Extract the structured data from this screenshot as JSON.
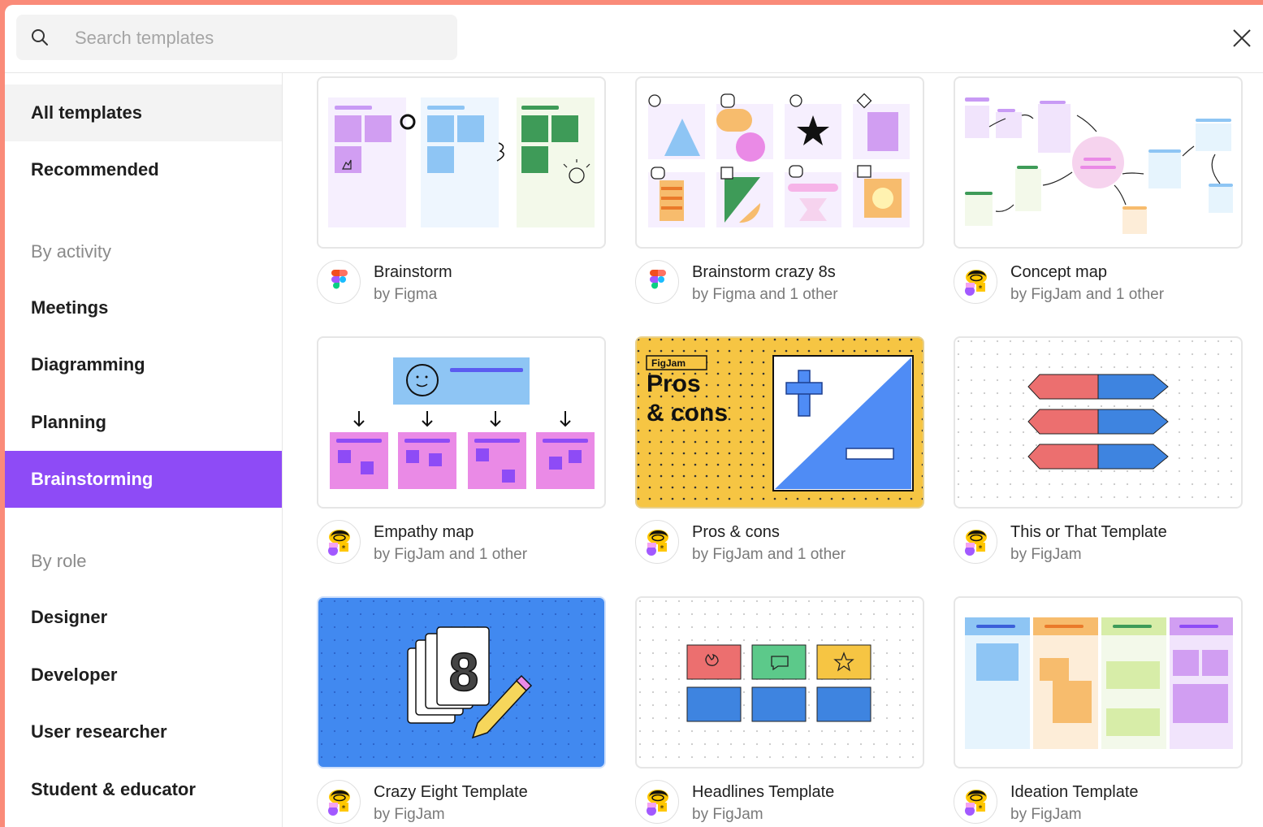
{
  "search": {
    "placeholder": "Search templates"
  },
  "sidebar": {
    "items": [
      {
        "label": "All templates"
      },
      {
        "label": "Recommended"
      },
      {
        "label": "Meetings"
      },
      {
        "label": "Diagramming"
      },
      {
        "label": "Planning"
      },
      {
        "label": "Brainstorming"
      },
      {
        "label": "Designer"
      },
      {
        "label": "Developer"
      },
      {
        "label": "User researcher"
      },
      {
        "label": "Student & educator"
      }
    ],
    "headings": {
      "activity": "By activity",
      "role": "By role"
    }
  },
  "templates": [
    {
      "title": "Brainstorm",
      "author": "by Figma",
      "avatar": "figma-logo-icon"
    },
    {
      "title": "Brainstorm crazy 8s",
      "author": "by Figma and 1 other",
      "avatar": "figma-logo-icon"
    },
    {
      "title": "Concept map",
      "author": "by FigJam and 1 other",
      "avatar": "figjam-logo-icon"
    },
    {
      "title": "Empathy map",
      "author": "by FigJam and 1 other",
      "avatar": "figjam-logo-icon"
    },
    {
      "title": "Pros & cons",
      "author": "by FigJam and 1 other",
      "avatar": "figjam-logo-icon",
      "thumb_brand": "FigJam",
      "thumb_line1": "Pros",
      "thumb_line2": "& cons"
    },
    {
      "title": "This or That Template",
      "author": "by FigJam",
      "avatar": "figjam-logo-icon"
    },
    {
      "title": "Crazy Eight Template",
      "author": "by FigJam",
      "avatar": "figjam-logo-icon",
      "thumb_number": "8"
    },
    {
      "title": "Headlines Template",
      "author": "by FigJam",
      "avatar": "figjam-logo-icon"
    },
    {
      "title": "Ideation Template",
      "author": "by FigJam",
      "avatar": "figjam-logo-icon"
    }
  ],
  "colors": {
    "accent": "#8E4BF6",
    "backdrop": "#FA8B79"
  }
}
